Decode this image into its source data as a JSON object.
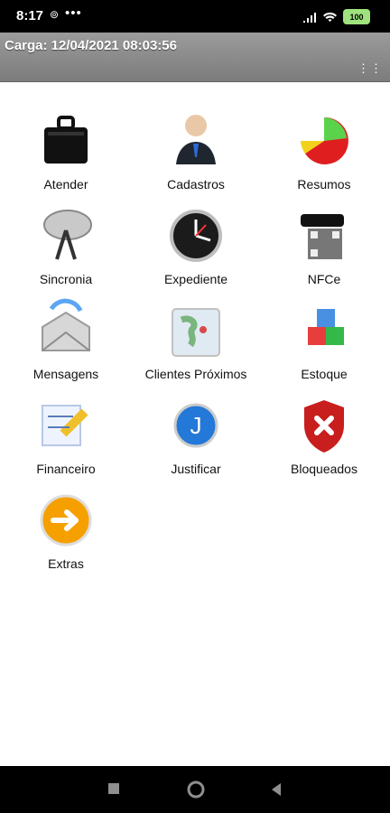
{
  "status": {
    "time": "8:17",
    "battery": "100"
  },
  "appbar": {
    "title": "Carga: 12/04/2021 08:03:56"
  },
  "menu": [
    {
      "label": "Atender",
      "icon": "briefcase-icon"
    },
    {
      "label": "Cadastros",
      "icon": "user-icon"
    },
    {
      "label": "Resumos",
      "icon": "pie-chart-icon"
    },
    {
      "label": "Sincronia",
      "icon": "satellite-dish-icon"
    },
    {
      "label": "Expediente",
      "icon": "clock-icon"
    },
    {
      "label": "NFCe",
      "icon": "phone-qr-icon"
    },
    {
      "label": "Mensagens",
      "icon": "envelope-icon"
    },
    {
      "label": "Clientes Próximos",
      "icon": "map-icon"
    },
    {
      "label": "Estoque",
      "icon": "cubes-icon"
    },
    {
      "label": "Financeiro",
      "icon": "math-ruler-icon"
    },
    {
      "label": "Justificar",
      "icon": "j-button-icon"
    },
    {
      "label": "Bloqueados",
      "icon": "blocked-shield-icon"
    },
    {
      "label": "Extras",
      "icon": "arrow-circle-icon"
    }
  ]
}
